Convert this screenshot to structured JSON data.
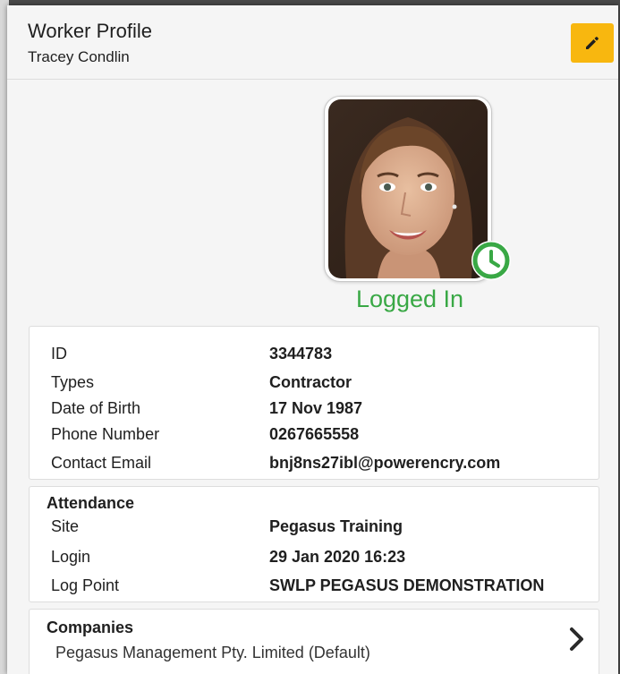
{
  "header": {
    "title": "Worker Profile",
    "subtitle": "Tracey Condlin"
  },
  "profile": {
    "status": "Logged In",
    "status_color": "#39a845"
  },
  "details": [
    {
      "label": "ID",
      "value": "3344783"
    },
    {
      "label": "Types",
      "value": "Contractor"
    },
    {
      "label": "Date of Birth",
      "value": "17 Nov 1987"
    },
    {
      "label": "Phone Number",
      "value": "0267665558"
    },
    {
      "label": "Contact Email",
      "value": "bnj8ns27ibl@powerencry.com"
    }
  ],
  "attendance": {
    "title": "Attendance",
    "rows": [
      {
        "label": "Site",
        "value": "Pegasus Training"
      },
      {
        "label": "Login",
        "value": "29 Jan 2020 16:23"
      },
      {
        "label": "Log Point",
        "value": "SWLP PEGASUS DEMONSTRATION"
      }
    ]
  },
  "companies": {
    "title": "Companies",
    "items": [
      "Pegasus Management Pty. Limited (Default)"
    ]
  },
  "icons": {
    "edit": "pencil-icon",
    "status": "clock-icon",
    "more": "chevron-right-icon"
  },
  "colors": {
    "accent": "#f8b70f",
    "status_green": "#39a845"
  }
}
